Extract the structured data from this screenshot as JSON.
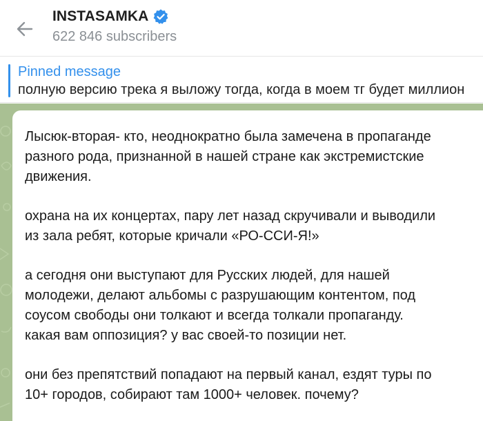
{
  "header": {
    "back_icon": "arrow-left-icon",
    "channel_title": "INSTASAMKA",
    "verified_icon": "verified-badge-icon",
    "subscribers": "622 846 subscribers"
  },
  "pinned": {
    "label": "Pinned message",
    "text": "полную версию трека я выложу тогда, когда в моем тг будет миллион"
  },
  "message": {
    "paragraphs": [
      "Лысюк-вторая- кто, неоднократно была замечена в пропаганде\nразного рода, признанной в нашей стране как экстремистские\nдвижения.",
      "охрана на их концертах, пару лет назад скручивали и выводили\nиз зала ребят, которые кричали «РО-ССИ-Я!»",
      "а сегодня они выступают для Русских людей, для нашей\nмолодежи, делают альбомы с разрушающим контентом, под\nсоусом свободы они толкают и всегда толкали пропаганду.\nкакая вам оппозиция? у вас своей-то позиции нет.",
      "они без препятствий попадают на первый канал, ездят туры по\n10+ городов, собирают там 1000+ человек.  почему?"
    ]
  },
  "colors": {
    "accent": "#3390ec",
    "chat_background": "#a9c093",
    "verified": "#3390ec"
  }
}
